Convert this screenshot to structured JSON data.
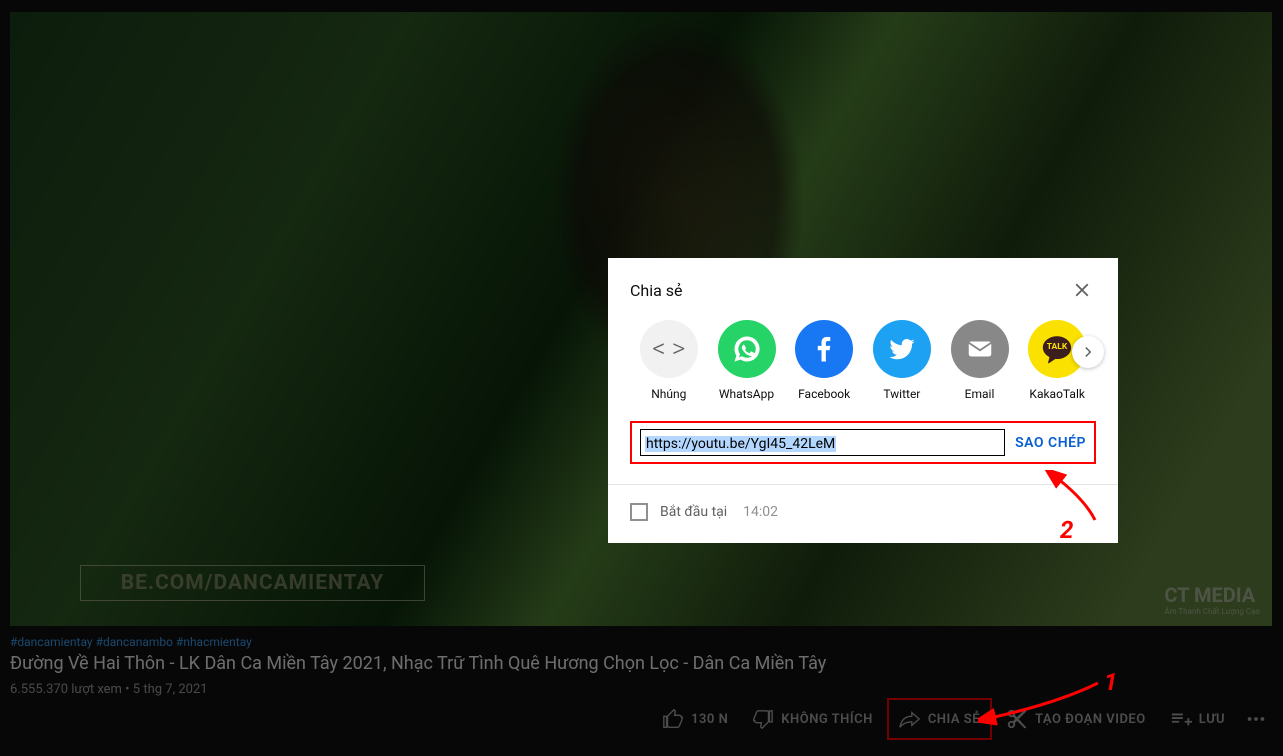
{
  "video": {
    "watermark": "BE.COM/DANCAMIENTAY",
    "brand": "CT MEDIA",
    "brand_sub": "Âm Thanh Chất Lượng Cao"
  },
  "meta": {
    "hashtags": "#dancamientay #dancanambo #nhacmientay",
    "title": "Đường Về Hai Thôn - LK Dân Ca Miền Tây 2021, Nhạc Trữ Tình Quê Hương Chọn Lọc - Dân Ca Miền Tây",
    "stats": "6.555.370 lượt xem • 5 thg 7, 2021"
  },
  "actions": {
    "like_count": "130 N",
    "dislike": "KHÔNG THÍCH",
    "share": "CHIA SẺ",
    "clip": "TẠO ĐOẠN VIDEO",
    "save": "LƯU"
  },
  "modal": {
    "title": "Chia sẻ",
    "targets": {
      "embed": "Nhúng",
      "whatsapp": "WhatsApp",
      "facebook": "Facebook",
      "twitter": "Twitter",
      "email": "Email",
      "kakao": "KakaoTalk"
    },
    "url": "https://youtu.be/YgI45_42LeM",
    "copy": "SAO CHÉP",
    "start_label": "Bắt đầu tại",
    "start_time": "14:02"
  },
  "annotations": {
    "n1": "1",
    "n2": "2"
  }
}
